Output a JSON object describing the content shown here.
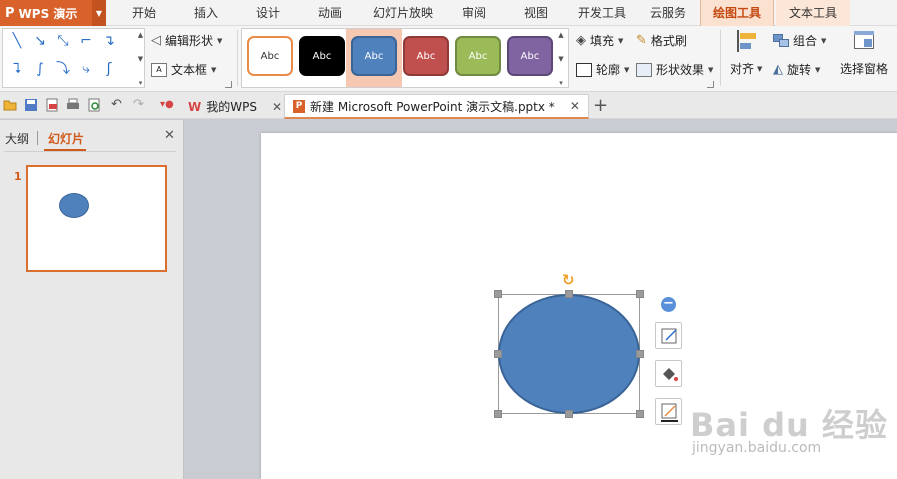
{
  "app": {
    "name": "WPS 演示",
    "logo": "P"
  },
  "menu_tabs": [
    {
      "label": "开始"
    },
    {
      "label": "插入"
    },
    {
      "label": "设计"
    },
    {
      "label": "动画"
    },
    {
      "label": "幻灯片放映"
    },
    {
      "label": "审阅"
    },
    {
      "label": "视图"
    },
    {
      "label": "开发工具"
    },
    {
      "label": "云服务"
    },
    {
      "label": "绘图工具"
    },
    {
      "label": "文本工具"
    }
  ],
  "ribbon": {
    "edit_shape": "编辑形状",
    "text_box": "文本框",
    "styles": [
      {
        "label": "Abc",
        "fill": "#ffffff",
        "border": "#e98c47",
        "text": "#333333"
      },
      {
        "label": "Abc",
        "fill": "#000000",
        "border": "#000000",
        "text": "#ffffff"
      },
      {
        "label": "Abc",
        "fill": "#4f81bd",
        "border": "#3a6396",
        "text": "#ffffff"
      },
      {
        "label": "Abc",
        "fill": "#c0504d",
        "border": "#8e3a38",
        "text": "#ffffff"
      },
      {
        "label": "Abc",
        "fill": "#9bbb59",
        "border": "#728a41",
        "text": "#ffffff"
      },
      {
        "label": "Abc",
        "fill": "#8064a2",
        "border": "#5c4876",
        "text": "#ffffff"
      }
    ],
    "fill": "填充",
    "format_painter": "格式刷",
    "outline": "轮廓",
    "shape_effects": "形状效果",
    "align": "对齐",
    "group": "组合",
    "rotate": "旋转",
    "selection_pane": "选择窗格"
  },
  "doc_tabs": [
    {
      "label": "我的WPS"
    },
    {
      "label": "新建 Microsoft PowerPoint 演示文稿.pptx *"
    }
  ],
  "left_panel": {
    "outline_tab": "大纲",
    "slides_tab": "幻灯片",
    "slide_number": "1"
  },
  "watermark": {
    "brand": "Bai du 经验",
    "url": "jingyan.baidu.com"
  },
  "colors": {
    "accent": "#d9622b",
    "shape_fill": "#4f81bd",
    "active_tab": "#fbe1cf"
  }
}
